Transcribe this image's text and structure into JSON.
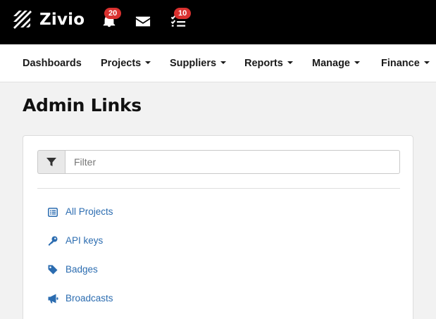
{
  "brand": {
    "name": "Zivio"
  },
  "topbar": {
    "notifications_count": "20",
    "tasks_count": "10"
  },
  "nav": {
    "items": [
      {
        "label": "Dashboards",
        "dropdown": false
      },
      {
        "label": "Projects",
        "dropdown": true
      },
      {
        "label": "Suppliers",
        "dropdown": true
      },
      {
        "label": "Reports",
        "dropdown": true
      },
      {
        "label": "Manage",
        "dropdown": true
      },
      {
        "label": "Finance",
        "dropdown": true
      }
    ]
  },
  "page": {
    "title": "Admin Links"
  },
  "filter": {
    "placeholder": "Filter",
    "value": ""
  },
  "links": [
    {
      "label": "All Projects",
      "icon": "list-icon"
    },
    {
      "label": "API keys",
      "icon": "key-icon"
    },
    {
      "label": "Badges",
      "icon": "tag-icon"
    },
    {
      "label": "Broadcasts",
      "icon": "bullhorn-icon"
    }
  ],
  "colors": {
    "topbar": "#000000",
    "badge": "#d9312f",
    "link": "#2b6cb0",
    "background": "#f2f2f2"
  }
}
